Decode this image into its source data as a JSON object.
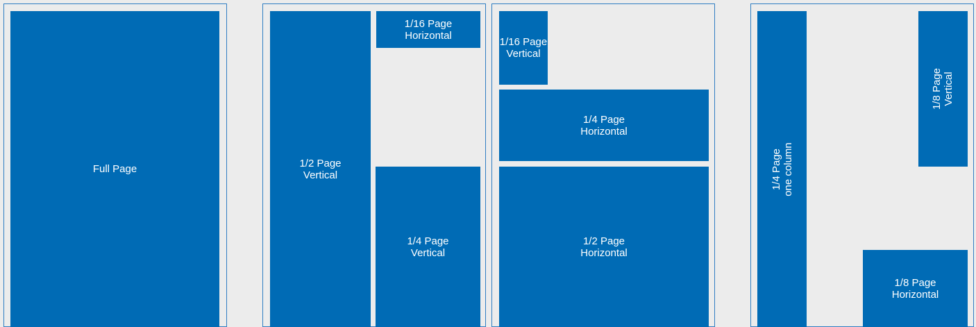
{
  "colors": {
    "background": "#ececec",
    "frame_border": "#2f7dc2",
    "ad_fill": "#006bb5",
    "ad_text": "#ffffff"
  },
  "ads": {
    "full_page": {
      "line1": "Full Page"
    },
    "half_vertical": {
      "line1": "1/2 Page",
      "line2": "Vertical"
    },
    "sixteenth_horizontal": {
      "line1": "1/16 Page",
      "line2": "Horizontal"
    },
    "quarter_vertical": {
      "line1": "1/4 Page",
      "line2": "Vertical"
    },
    "sixteenth_vertical": {
      "line1": "1/16 Page",
      "line2": "Vertical"
    },
    "quarter_horizontal": {
      "line1": "1/4 Page",
      "line2": "Horizontal"
    },
    "half_horizontal": {
      "line1": "1/2 Page",
      "line2": "Horizontal"
    },
    "quarter_one_column": {
      "line1": "1/4 Page",
      "line2": "one column"
    },
    "eighth_vertical": {
      "line1": "1/8 Page",
      "line2": "Vertical"
    },
    "eighth_horizontal": {
      "line1": "1/8 Page",
      "line2": "Horizontal"
    }
  }
}
